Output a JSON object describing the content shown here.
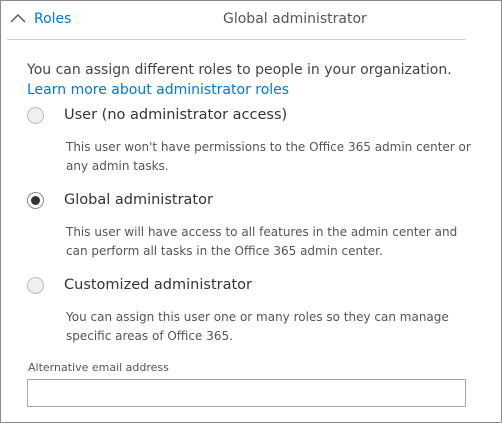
{
  "header": {
    "section_label": "Roles",
    "current_role": "Global administrator",
    "expand_icon": "chevron-up-icon"
  },
  "intro": {
    "text": "You can assign different roles to people in your organization. ",
    "link_text": "Learn more about administrator roles"
  },
  "options": [
    {
      "label": "User (no administrator access)",
      "description": "This user won't have permissions to the Office 365 admin center or any admin tasks.",
      "selected": false
    },
    {
      "label": "Global administrator",
      "description": "This user will have access to all features in the admin center and can perform all tasks in the Office 365 admin center.",
      "selected": true
    },
    {
      "label": "Customized administrator",
      "description": "You can assign this user one or many roles so they can manage specific areas of Office 365.",
      "selected": false
    }
  ],
  "alt_email": {
    "label": "Alternative email address",
    "value": "",
    "placeholder": ""
  },
  "colors": {
    "link": "#0078d4",
    "text": "#333333",
    "divider": "#d0d0d0"
  }
}
